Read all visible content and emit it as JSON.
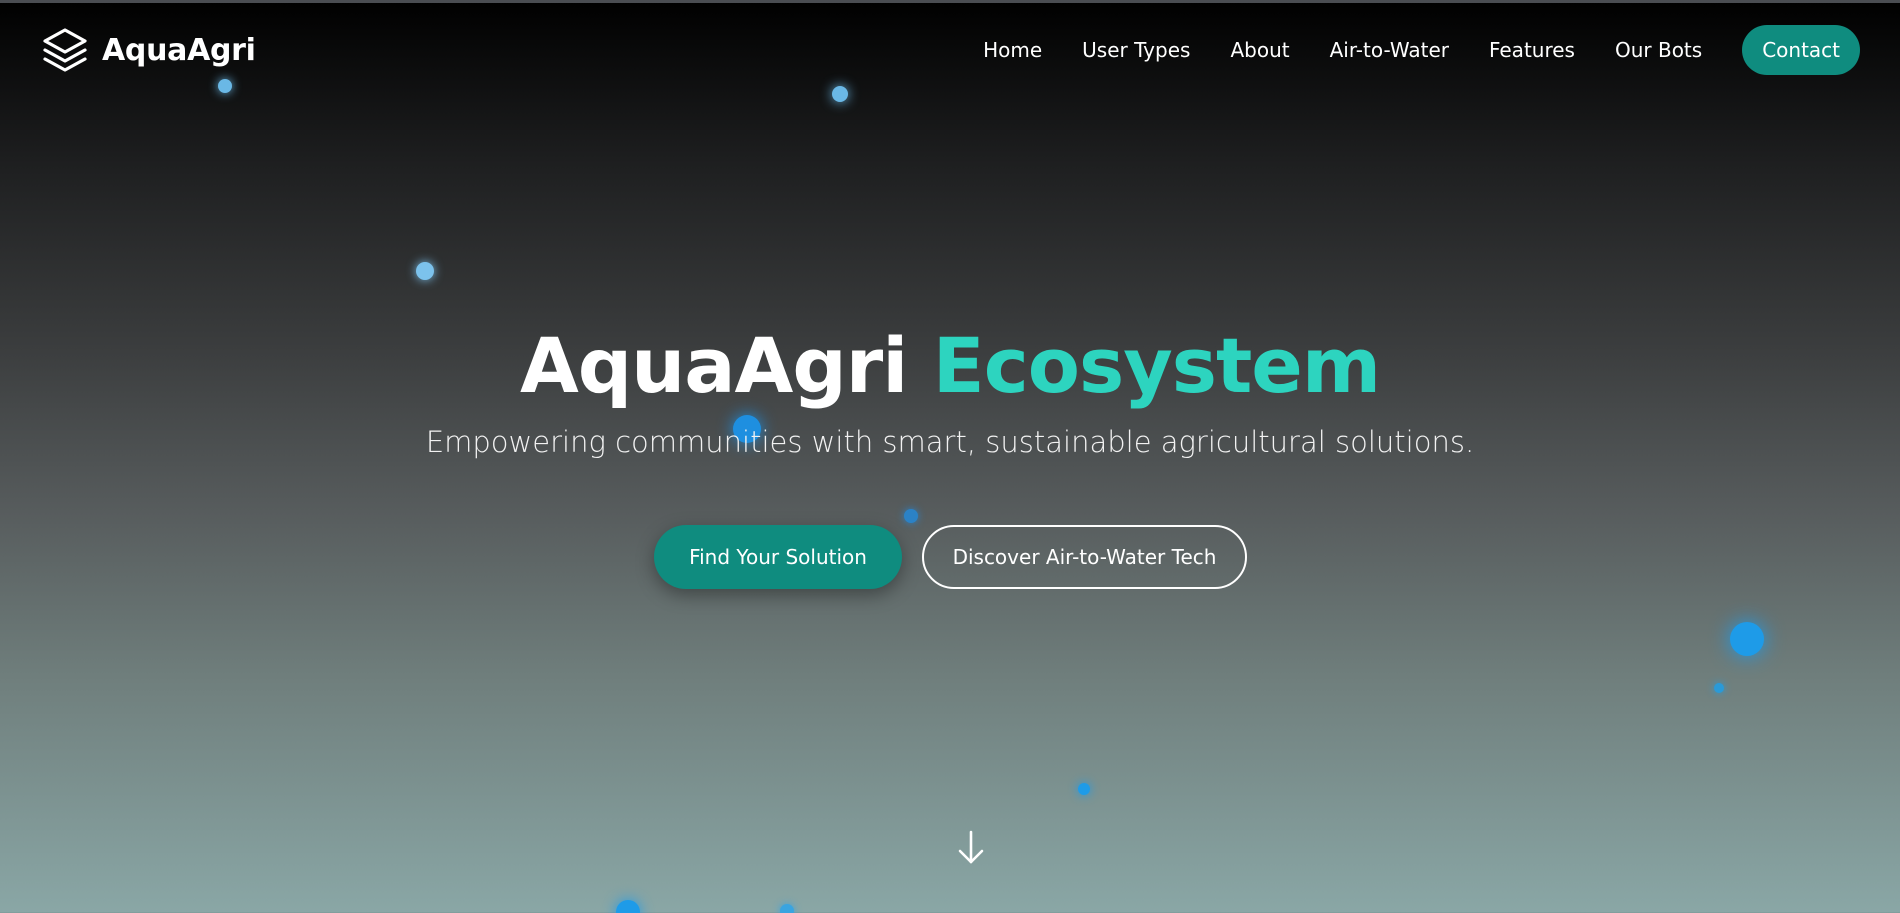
{
  "brand": {
    "name": "AquaAgri",
    "logo_icon": "layers-icon"
  },
  "nav": {
    "links": [
      "Home",
      "User Types",
      "About",
      "Air-to-Water",
      "Features",
      "Our Bots"
    ],
    "contact_label": "Contact"
  },
  "hero": {
    "title_main": "AquaAgri",
    "title_accent": "Ecosystem",
    "subtitle": "Empowering communities with smart, sustainable agricultural solutions.",
    "primary_cta": "Find Your Solution",
    "secondary_cta": "Discover Air-to-Water Tech",
    "scroll_icon": "arrow-down-icon"
  },
  "colors": {
    "accent": "#2dd4bf",
    "button": "#0f8c7f",
    "particle": "#38a8e8"
  }
}
